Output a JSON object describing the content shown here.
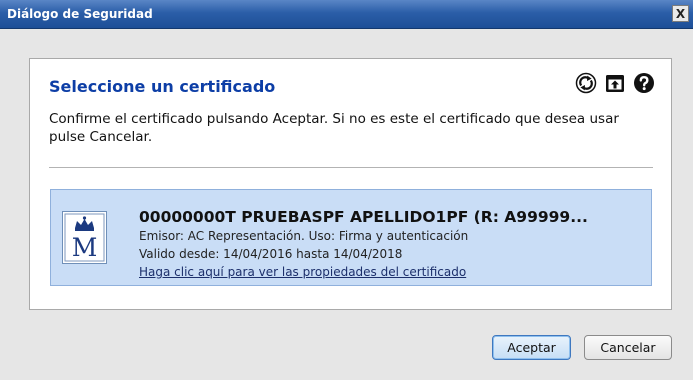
{
  "window": {
    "title": "Diálogo de Seguridad",
    "close_label": "X"
  },
  "dialog": {
    "heading": "Seleccione un certificado",
    "description": "Confirme el certificado pulsando Aceptar. Si no es este el certificado que desea usar pulse Cancelar.",
    "toolbar_icons": [
      "refresh-icon",
      "import-icon",
      "help-icon"
    ]
  },
  "certificate": {
    "name": "00000000T PRUEBASPF APELLIDO1PF (R: A99999...",
    "issuer": "Emisor: AC Representación. Uso: Firma y autenticación",
    "validity": "Valido desde: 14/04/2016 hasta 14/04/2018",
    "properties_link": "Haga clic aquí para ver las propiedades del certificado",
    "icon": "crown-m-icon",
    "selected_background": "#c9ddf6"
  },
  "buttons": {
    "accept": "Aceptar",
    "cancel": "Cancelar"
  },
  "colors": {
    "heading": "#0d3ea6",
    "titlebar": "#2b5ea8"
  }
}
